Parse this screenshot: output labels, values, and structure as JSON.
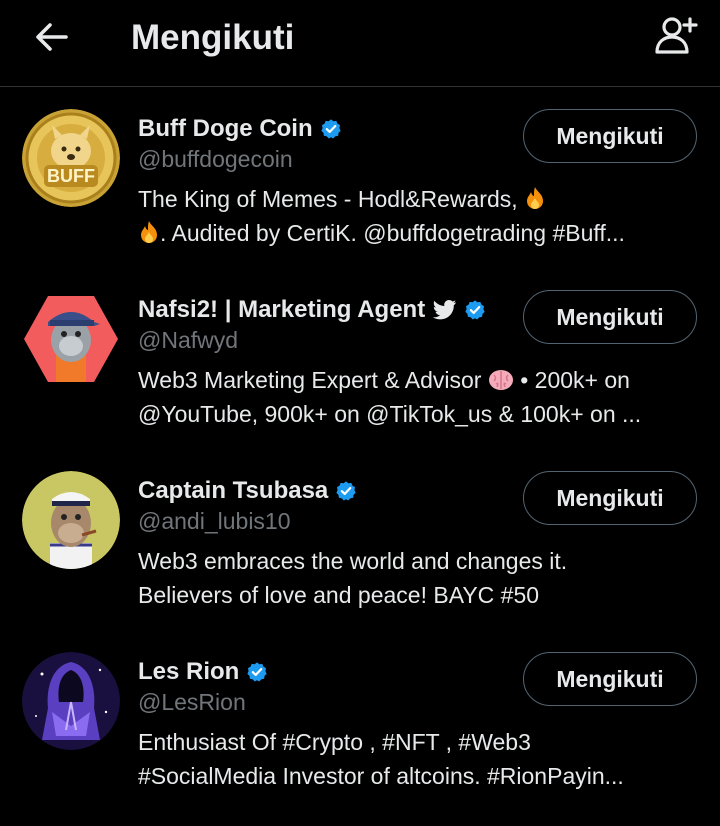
{
  "header": {
    "title": "Mengikuti",
    "back_icon": "arrow-left-icon",
    "add_icon": "user-plus-icon"
  },
  "users": [
    {
      "name": "Buff Doge Coin",
      "handle": "@buffdogecoin",
      "bio_1": "The King of Memes - Hodl&Rewards,",
      "bio_2a": ". Audited by CertiK. @buffdogetrading #Buff...",
      "button": "Mengikuti"
    },
    {
      "name": "Nafsi2! | Marketing Agent",
      "handle": "@Nafwyd",
      "bio_1a": "Web3 Marketing Expert & Advisor",
      "bio_1b": " • 200k+ on",
      "bio_2": "@YouTube, 900k+ on @TikTok_us & 100k+ on ...",
      "button": "Mengikuti"
    },
    {
      "name": "Captain Tsubasa",
      "handle": "@andi_lubis10",
      "bio_1": "Web3 embraces the world and changes it.",
      "bio_2": "Believers of love and peace! BAYC #50",
      "button": "Mengikuti"
    },
    {
      "name": "Les Rion",
      "handle": "@LesRion",
      "bio_1": "Enthusiast Of #Crypto , #NFT , #Web3",
      "bio_2": "#SocialMedia Investor of altcoins. #RionPayin...",
      "button": "Mengikuti"
    }
  ],
  "colors": {
    "background": "#000000",
    "text": "#e7e9ea",
    "secondary": "#71767b",
    "verified": "#1d9bf0",
    "border": "#536471"
  }
}
